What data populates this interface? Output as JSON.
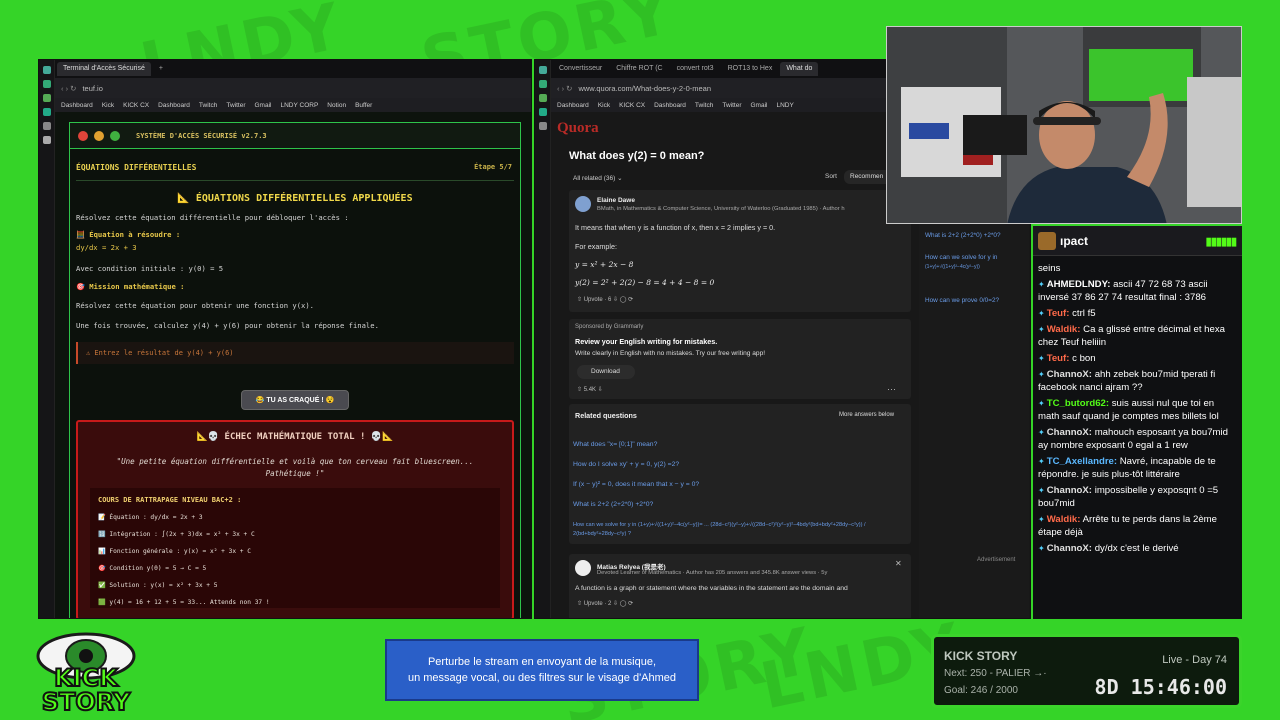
{
  "left_window": {
    "tab_title": "Terminal d'Accès Sécurisé",
    "url": "teuf.io",
    "bookmarks": [
      "Dashboard",
      "Kick",
      "KICK CX",
      "Dashboard",
      "Twitch",
      "Twitter",
      "Gmail",
      "LNDY CORP",
      "Notion",
      "Buffer"
    ],
    "terminal": {
      "title": "SYSTÈME D'ACCÈS SÉCURISÉ v2.7.3",
      "section": "ÉQUATIONS DIFFÉRENTIELLES",
      "step": "Étape 5/7",
      "heading": "📐 ÉQUATIONS DIFFÉRENTIELLES APPLIQUÉES",
      "intro": "Résolvez cette équation différentielle pour débloquer l'accès :",
      "eq_label": "🧮 Équation à résoudre :",
      "eq": "dy/dx = 2x + 3",
      "cond": "Avec condition initiale : y(0) = 5",
      "mission_label": "🎯 Mission mathématique :",
      "mission1": "Résolvez cette équation pour obtenir une fonction y(x).",
      "mission2": "Une fois trouvée, calculez y(4) + y(6) pour obtenir la réponse finale.",
      "input_placeholder": "⚠ Entrez le résultat de y(4) + y(6)",
      "crack_button": "😂 TU AS CRAQUÉ ! 😵",
      "fail_title": "📐💀 ÉCHEC MATHÉMATIQUE TOTAL ! 💀📐",
      "fail_quote": "\"Une petite équation différentielle et voilà que ton cerveau fait bluescreen... Pathétique !\"",
      "course_title": "COURS DE RATTRAPAGE NIVEAU BAC+2 :",
      "course_lines": [
        "📝 Équation : dy/dx = 2x + 3",
        "🔢 Intégration : ∫(2x + 3)dx = x² + 3x + C",
        "📊 Fonction générale : y(x) = x² + 3x + C",
        "🎯 Condition y(0) = 5 → C = 5",
        "✅ Solution : y(x) = x² + 3x + 5",
        "🟩 y(4) = 16 + 12 + 5 = 33... Attends non 37 !"
      ]
    }
  },
  "right_window": {
    "tabs": [
      "Convertisseur",
      "Chiffre ROT (C",
      "convert rot3",
      "ROT13 to Hex",
      "What do"
    ],
    "url": "www.quora.com/What-does-y-2-0-mean",
    "bookmarks": [
      "Dashboard",
      "Kick",
      "KICK CX",
      "Dashboard",
      "Twitch",
      "Twitter",
      "Gmail",
      "LNDY"
    ],
    "logo": "Quora",
    "question": "What does y(2) = 0 mean?",
    "filter": "All related (36) ⌄",
    "sort_label": "Sort",
    "sort_value": "Recommen",
    "answer1": {
      "author": "Elaine Dawe",
      "desc": "BMath, in Mathematics & Computer Science, University of Waterloo (Graduated 1985) · Author h",
      "line1": "It means that when y is a function of x, then x = 2 implies y = 0.",
      "line2": "For example:",
      "eq1": "y = x² + 2x − 8",
      "eq2": "y(2) = 2² + 2(2) − 8 = 4 + 4 − 8 = 0",
      "votes": "⇧ Upvote · 6   ⇩   ◯   ⟳"
    },
    "ad": {
      "sponsor": "Sponsored by Grammarly",
      "title": "Review your English writing for mistakes.",
      "body": "Write clearly in English with no mistakes. Try our free writing app!",
      "button": "Download",
      "votes": "⇧ 5.4K   ⇩",
      "more": "···"
    },
    "related": {
      "title": "Related questions",
      "more": "More answers below",
      "items": [
        "What does \"x= [0;1]\" mean?",
        "How do I solve xy' + y = 0, y(2) =2?",
        "If (x − y)² = 0, does it mean that x − y = 0?",
        "What is 2+2 (2+2*0) +2*0?",
        "How can we solve for y in (1+y)+√((1+y)²−4c(y²−y))= ... (28d−c²)(y²−y)+√((28d−c²)²(y²−y)²−4bdy²(bd+bdy²+28dy−c²y)) / 2(bd+bdy²+28dy−c²y) ?"
      ]
    },
    "answer2": {
      "author": "Matias Relyea (我是老)",
      "desc": "Devoted Learner of Mathematics · Author has 205 answers and 345.8K answer views · 5y",
      "line1": "A function is a graph or statement where the variables in the statement are the domain and",
      "votes": "⇧ Upvote · 2   ⇩   ◯   ⟳",
      "close": "✕"
    },
    "sidebar": {
      "items": [
        "What is 2+2 (2+2*0) +2*0?",
        "How can we solve for y in",
        "(1+y)+√((1+y)²−4c(y²−y))",
        "How can we prove 0/0=2?"
      ],
      "ad_label": "Advertisement"
    }
  },
  "chat": {
    "title": "ıpact",
    "messages": [
      {
        "user": "",
        "text": "seins",
        "color": "#ffffff"
      },
      {
        "user": "AHMEDLNDY:",
        "text": "ascii 47 72 68 73 ascii inversé 37 86 27 74 resultat final : 3786",
        "color": "#ffffff"
      },
      {
        "user": "Teuf:",
        "text": "ctrl f5",
        "color": "#ff6a4a"
      },
      {
        "user": "Waldik:",
        "text": "Ca a glissé entre décimal et hexa chez Teuf heliiin",
        "color": "#ff6a4a"
      },
      {
        "user": "Teuf:",
        "text": "c bon",
        "color": "#ff6a4a"
      },
      {
        "user": "ChannoX:",
        "text": "ahh zebek bou7mid tperati fi facebook nanci ajram ??",
        "color": "#e0e0e0"
      },
      {
        "user": "TC_butord62:",
        "text": "suis aussi nul que toi en math sauf quand je comptes mes billets lol",
        "color": "#53fc18"
      },
      {
        "user": "ChannoX:",
        "text": "mahouch esposant ya bou7mid ay nombre exposant 0 egal a 1 rew",
        "color": "#e0e0e0"
      },
      {
        "user": "TC_Axellandre:",
        "text": "Navré, incapable de te répondre. je suis plus-tôt littéraire",
        "color": "#5ab8ff"
      },
      {
        "user": "ChannoX:",
        "text": "impossibelle y exposqnt 0 =5 bou7mid",
        "color": "#e0e0e0"
      },
      {
        "user": "Waldik:",
        "text": "Arrête tu te perds dans la 2ème étape déjà",
        "color": "#ff6a4a"
      },
      {
        "user": "ChannoX:",
        "text": "dy/dx c'est le derivé",
        "color": "#e0e0e0"
      }
    ]
  },
  "banner": {
    "line1": "Perturbe le stream en envoyant de la musique,",
    "line2": "un message vocal, ou des filtres sur le visage d'Ahmed"
  },
  "kick_story": {
    "title": "KICK STORY",
    "live": "Live - Day 74",
    "next": "Next: 250 - PALIER →·",
    "goal": "Goal: 246 / 2000",
    "timer": "8D 15:46:00"
  },
  "logo_text": {
    "line1": "KICK",
    "line2": "STORY"
  },
  "colors": {
    "kick_green": "#53fc18",
    "terminal_green": "#2ec34a",
    "fail_red": "#c81a1a",
    "quora_red": "#b92b27",
    "link_blue": "#6a9ce8"
  }
}
